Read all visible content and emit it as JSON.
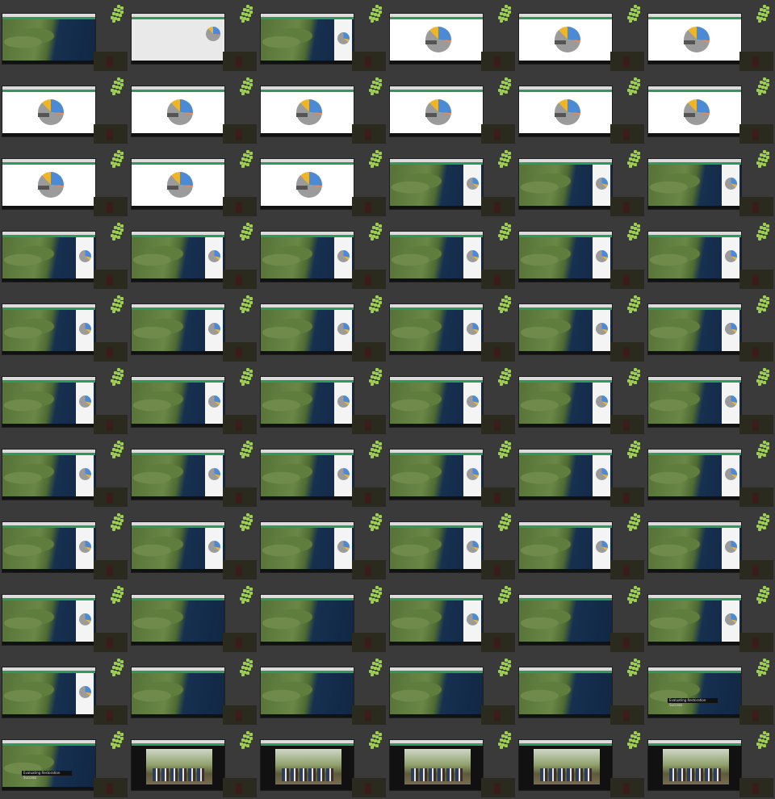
{
  "sheet": {
    "background": "#3a3a3a",
    "columns": 6,
    "rows": 11,
    "accent_green": "#2e9a57",
    "logo_green": "#9ccf4f"
  },
  "frames": [
    {
      "kind": "map-plain"
    },
    {
      "kind": "blank-dialog"
    },
    {
      "kind": "map-pie"
    },
    {
      "kind": "pie-chart"
    },
    {
      "kind": "pie-chart"
    },
    {
      "kind": "pie-chart"
    },
    {
      "kind": "pie-chart"
    },
    {
      "kind": "pie-chart"
    },
    {
      "kind": "pie-chart"
    },
    {
      "kind": "pie-chart"
    },
    {
      "kind": "pie-chart"
    },
    {
      "kind": "pie-chart"
    },
    {
      "kind": "pie-chart"
    },
    {
      "kind": "pie-chart"
    },
    {
      "kind": "pie-chart"
    },
    {
      "kind": "map-pie"
    },
    {
      "kind": "map-pie"
    },
    {
      "kind": "map-pie"
    },
    {
      "kind": "map-pie"
    },
    {
      "kind": "map-pie"
    },
    {
      "kind": "map-pie"
    },
    {
      "kind": "map-pie"
    },
    {
      "kind": "map-pie"
    },
    {
      "kind": "map-pie"
    },
    {
      "kind": "map-pie"
    },
    {
      "kind": "map-pie"
    },
    {
      "kind": "map-pie"
    },
    {
      "kind": "map-pie"
    },
    {
      "kind": "map-pie"
    },
    {
      "kind": "map-pie"
    },
    {
      "kind": "map-pie"
    },
    {
      "kind": "map-pie"
    },
    {
      "kind": "map-pie"
    },
    {
      "kind": "map-pie"
    },
    {
      "kind": "map-pie"
    },
    {
      "kind": "map-pie"
    },
    {
      "kind": "map-pie"
    },
    {
      "kind": "map-pie"
    },
    {
      "kind": "map-pie"
    },
    {
      "kind": "map-pie"
    },
    {
      "kind": "map-pie"
    },
    {
      "kind": "map-pie"
    },
    {
      "kind": "map-pie"
    },
    {
      "kind": "map-pie"
    },
    {
      "kind": "map-pie"
    },
    {
      "kind": "map-pie"
    },
    {
      "kind": "map-pie"
    },
    {
      "kind": "map-pie"
    },
    {
      "kind": "map-pie"
    },
    {
      "kind": "map-plain"
    },
    {
      "kind": "map-plain"
    },
    {
      "kind": "map-pie"
    },
    {
      "kind": "map-plain"
    },
    {
      "kind": "map-pie"
    },
    {
      "kind": "map-pie"
    },
    {
      "kind": "map-plain"
    },
    {
      "kind": "map-plain"
    },
    {
      "kind": "map-plain"
    },
    {
      "kind": "map-plain"
    },
    {
      "kind": "map-banner"
    },
    {
      "kind": "map-banner"
    },
    {
      "kind": "video"
    },
    {
      "kind": "video"
    },
    {
      "kind": "video"
    },
    {
      "kind": "video"
    },
    {
      "kind": "video"
    }
  ],
  "banner_text": "Evaluating Restoration Success"
}
